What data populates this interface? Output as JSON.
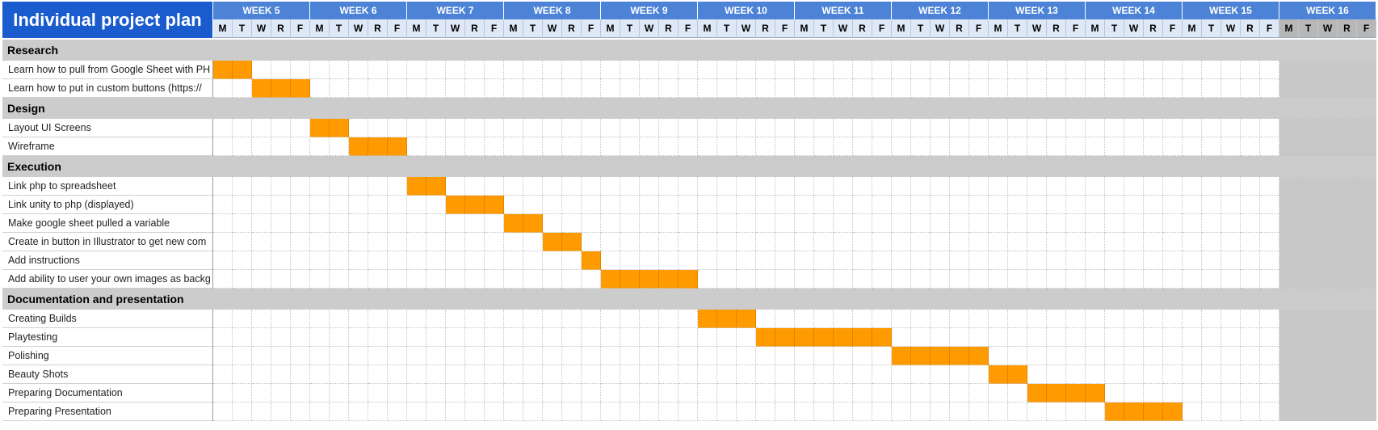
{
  "title": "Individual project plan",
  "weeks": [
    "WEEK 5",
    "WEEK 6",
    "WEEK 7",
    "WEEK 8",
    "WEEK 9",
    "WEEK 10",
    "WEEK 11",
    "WEEK 12",
    "WEEK 13",
    "WEEK 14",
    "WEEK 15",
    "WEEK 16"
  ],
  "day_letters": [
    "M",
    "T",
    "W",
    "R",
    "F"
  ],
  "colors": {
    "title_bg": "#1a5ccd",
    "week_bg": "#4c83d6",
    "day_bg": "#dfe8f6",
    "section_bg": "#cccccc",
    "bar": "#ff9a00"
  },
  "rows": [
    {
      "type": "section",
      "label": "Research"
    },
    {
      "type": "task",
      "label": "Learn how to pull from Google Sheet with PH",
      "start": 0,
      "len": 2
    },
    {
      "type": "task",
      "label": "Learn how to put in custom buttons (https://",
      "start": 2,
      "len": 3
    },
    {
      "type": "section",
      "label": "Design"
    },
    {
      "type": "task",
      "label": "Layout UI Screens",
      "start": 5,
      "len": 2
    },
    {
      "type": "task",
      "label": "Wireframe",
      "start": 7,
      "len": 3
    },
    {
      "type": "section",
      "label": "Execution"
    },
    {
      "type": "task",
      "label": "Link php to spreadsheet",
      "start": 10,
      "len": 2
    },
    {
      "type": "task",
      "label": "Link unity to php (displayed)",
      "start": 12,
      "len": 3
    },
    {
      "type": "task",
      "label": "Make google sheet pulled a variable",
      "start": 15,
      "len": 2
    },
    {
      "type": "task",
      "label": "Create in button in Illustrator to get new com",
      "start": 17,
      "len": 2
    },
    {
      "type": "task",
      "label": "Add instructions",
      "start": 19,
      "len": 1
    },
    {
      "type": "task",
      "label": "Add ability to user your own images as backg",
      "start": 20,
      "len": 5
    },
    {
      "type": "section",
      "label": "Documentation and presentation"
    },
    {
      "type": "task",
      "label": "Creating Builds",
      "start": 25,
      "len": 3
    },
    {
      "type": "task",
      "label": "Playtesting",
      "start": 28,
      "len": 7
    },
    {
      "type": "task",
      "label": "Polishing",
      "start": 35,
      "len": 5
    },
    {
      "type": "task",
      "label": "Beauty Shots",
      "start": 40,
      "len": 2
    },
    {
      "type": "task",
      "label": "Preparing Documentation",
      "start": 42,
      "len": 4
    },
    {
      "type": "task",
      "label": "Preparing Presentation",
      "start": 46,
      "len": 4
    }
  ]
}
